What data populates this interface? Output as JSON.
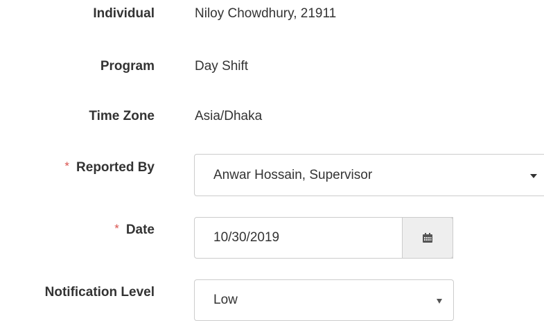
{
  "fields": {
    "individual": {
      "label": "Individual",
      "value": "Niloy Chowdhury, 21911"
    },
    "program": {
      "label": "Program",
      "value": "Day Shift"
    },
    "time_zone": {
      "label": "Time Zone",
      "value": "Asia/Dhaka"
    },
    "reported_by": {
      "required_mark": "*",
      "label": "Reported By",
      "value": "Anwar Hossain, Supervisor"
    },
    "date": {
      "required_mark": "*",
      "label": "Date",
      "value": "10/30/2019"
    },
    "notification_level": {
      "label": "Notification Level",
      "value": "Low"
    }
  },
  "icons": {
    "date_picker": "calendar-icon",
    "reported_by_dropdown": "caret-down-icon",
    "notification_dropdown": "caret-down-icon"
  },
  "colors": {
    "required": "#d9534f",
    "text": "#333333",
    "border": "#cccccc",
    "addon_bg": "#eeeeee"
  }
}
